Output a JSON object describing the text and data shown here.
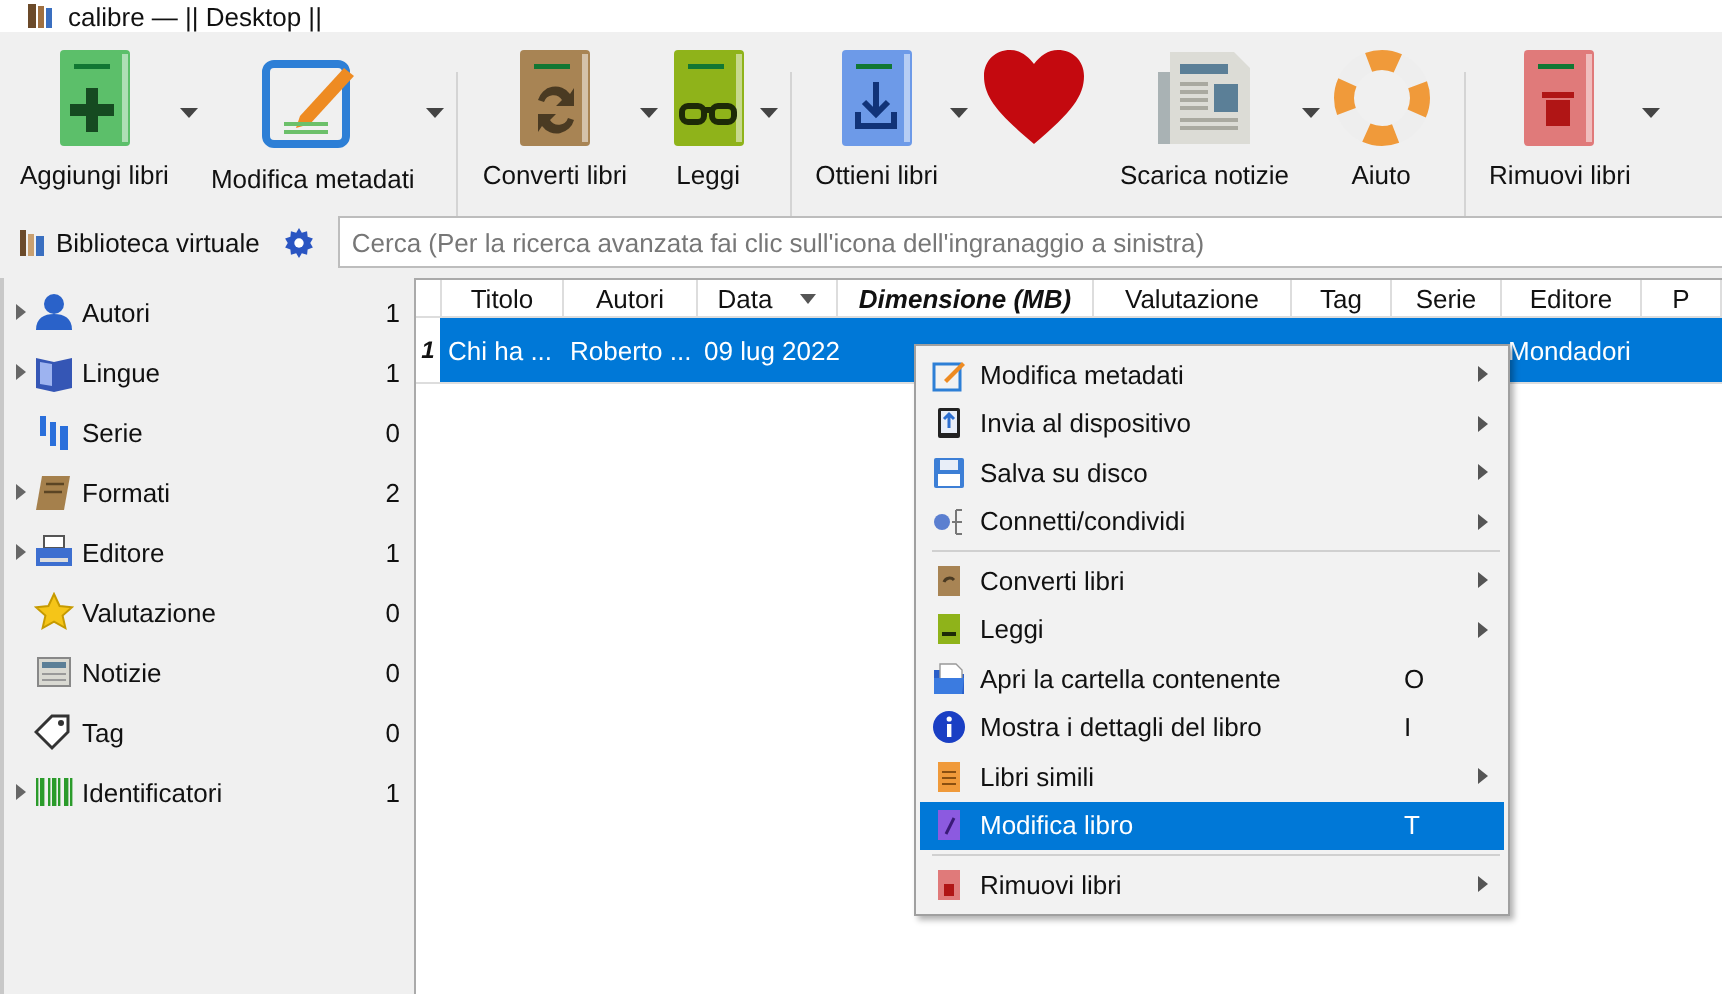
{
  "window": {
    "title": "calibre — || Desktop ||"
  },
  "toolbar": {
    "groups": [
      [
        {
          "label": "Aggiungi libri",
          "dropdown": true
        },
        {
          "label": "Modifica metadati",
          "dropdown": true
        }
      ],
      [
        {
          "label": "Converti libri",
          "dropdown": true
        },
        {
          "label": "Leggi",
          "dropdown": true
        }
      ],
      [
        {
          "label": "Ottieni libri",
          "dropdown": true
        },
        {
          "dropdown": false
        },
        {
          "label": "Scarica notizie",
          "dropdown": true
        },
        {
          "label": "Aiuto",
          "dropdown": false
        }
      ],
      [
        {
          "label": "Rimuovi libri",
          "dropdown": true
        }
      ]
    ]
  },
  "virtual_library": {
    "label": "Biblioteca virtuale"
  },
  "search": {
    "placeholder": "Cerca (Per la ricerca avanzata fai clic sull'icona dell'ingranaggio a sinistra)"
  },
  "sidebar": {
    "items": [
      {
        "label": "Autori",
        "count": "1",
        "expandable": true
      },
      {
        "label": "Lingue",
        "count": "1",
        "expandable": true
      },
      {
        "label": "Serie",
        "count": "0",
        "expandable": false
      },
      {
        "label": "Formati",
        "count": "2",
        "expandable": true
      },
      {
        "label": "Editore",
        "count": "1",
        "expandable": true
      },
      {
        "label": "Valutazione",
        "count": "0",
        "expandable": false
      },
      {
        "label": "Notizie",
        "count": "0",
        "expandable": false
      },
      {
        "label": "Tag",
        "count": "0",
        "expandable": false
      },
      {
        "label": "Identificatori",
        "count": "1",
        "expandable": true
      }
    ]
  },
  "table": {
    "columns": [
      {
        "label": "Titolo",
        "sorted": false,
        "emphasized": false
      },
      {
        "label": "Autori",
        "sorted": false,
        "emphasized": false
      },
      {
        "label": "Data",
        "sorted": true,
        "emphasized": false
      },
      {
        "label": "Dimensione (MB)",
        "sorted": false,
        "emphasized": true
      },
      {
        "label": "Valutazione",
        "sorted": false,
        "emphasized": false
      },
      {
        "label": "Tag",
        "sorted": false,
        "emphasized": false
      },
      {
        "label": "Serie",
        "sorted": false,
        "emphasized": false
      },
      {
        "label": "Editore",
        "sorted": false,
        "emphasized": false
      },
      {
        "label": "P",
        "sorted": false,
        "emphasized": false
      }
    ],
    "rows": [
      {
        "number": "1",
        "selected": true,
        "cells": {
          "titolo": "Chi ha ...",
          "autori": "Roberto ...",
          "data": "09 lug 2022",
          "editore": "Mondadori"
        }
      }
    ]
  },
  "context_menu": {
    "sections": [
      [
        {
          "label": "Modifica metadati",
          "submenu": true,
          "selected": false
        },
        {
          "label": "Invia al dispositivo",
          "submenu": true,
          "selected": false
        },
        {
          "label": "Salva su disco",
          "submenu": true,
          "selected": false
        },
        {
          "label": "Connetti/condividi",
          "submenu": true,
          "selected": false
        }
      ],
      [
        {
          "label": "Converti libri",
          "submenu": true,
          "selected": false
        },
        {
          "label": "Leggi",
          "submenu": true,
          "selected": false
        },
        {
          "label": "Apri la cartella contenente",
          "shortcut": "O",
          "submenu": false,
          "selected": false
        },
        {
          "label": "Mostra i dettagli del libro",
          "shortcut": "I",
          "submenu": false,
          "selected": false
        },
        {
          "label": "Libri simili",
          "submenu": true,
          "selected": false
        },
        {
          "label": "Modifica libro",
          "shortcut": "T",
          "submenu": false,
          "selected": true
        }
      ],
      [
        {
          "label": "Rimuovi libri",
          "submenu": true,
          "selected": false
        }
      ]
    ]
  }
}
